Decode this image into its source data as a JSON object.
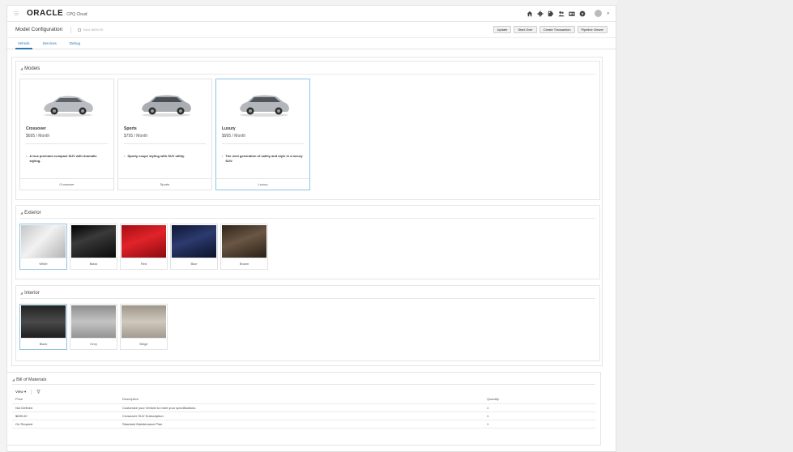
{
  "topbar": {
    "brand": "ORACLE",
    "product": "CPQ Cloud",
    "icons": [
      "home-icon",
      "gear-icon",
      "tag-icon",
      "users-icon",
      "id-card-icon",
      "help-icon",
      "user-avatar"
    ]
  },
  "header": {
    "title": "Model Configuration",
    "total": "Total: $695.00",
    "buttons": [
      "Update",
      "Start Over",
      "Create Transaction",
      "Pipeline Viewer"
    ]
  },
  "tabs": [
    "Vehicle",
    "Services",
    "Debug"
  ],
  "models": {
    "title": "Models",
    "cards": [
      {
        "name": "Crossover",
        "price": "$695 / Month",
        "description": "A true premium compact SUV with dramatic styling.",
        "footer": "Crossover"
      },
      {
        "name": "Sports",
        "price": "$795 / Month",
        "description": "Sporty coupe styling with SUV utility.",
        "footer": "Sports"
      },
      {
        "name": "Luxury",
        "price": "$995 / Month",
        "description": "The next generation of safety and style in a luxury SUV.",
        "footer": "Luxury"
      }
    ],
    "selected": "Luxury"
  },
  "exterior": {
    "title": "Exterior",
    "options": [
      {
        "label": "White",
        "color": "#d6d6d6"
      },
      {
        "label": "Black",
        "color": "#1a1a1a"
      },
      {
        "label": "Red",
        "color": "#c8141a"
      },
      {
        "label": "Blue",
        "color": "#1c2750"
      },
      {
        "label": "Brown",
        "color": "#4a3a2c"
      }
    ],
    "selected": "White"
  },
  "interior": {
    "title": "Interior",
    "options": [
      {
        "label": "Black",
        "color": "#3a3a3a"
      },
      {
        "label": "Grey",
        "color": "#a9a9a9"
      },
      {
        "label": "Beige",
        "color": "#b5aea3"
      }
    ],
    "selected": "Black"
  },
  "bom": {
    "title": "Bill of Materials",
    "view_label": "View",
    "columns": [
      "Price",
      "Description",
      "Quantity"
    ],
    "rows": [
      [
        "Not Defined",
        "Customize your Vehicle to meet your specifications.",
        "1"
      ],
      [
        "$695.00",
        "Crossover SUV Subscription",
        "1"
      ],
      [
        "On Request",
        "Standard Maintenance Plan",
        "1"
      ]
    ]
  }
}
